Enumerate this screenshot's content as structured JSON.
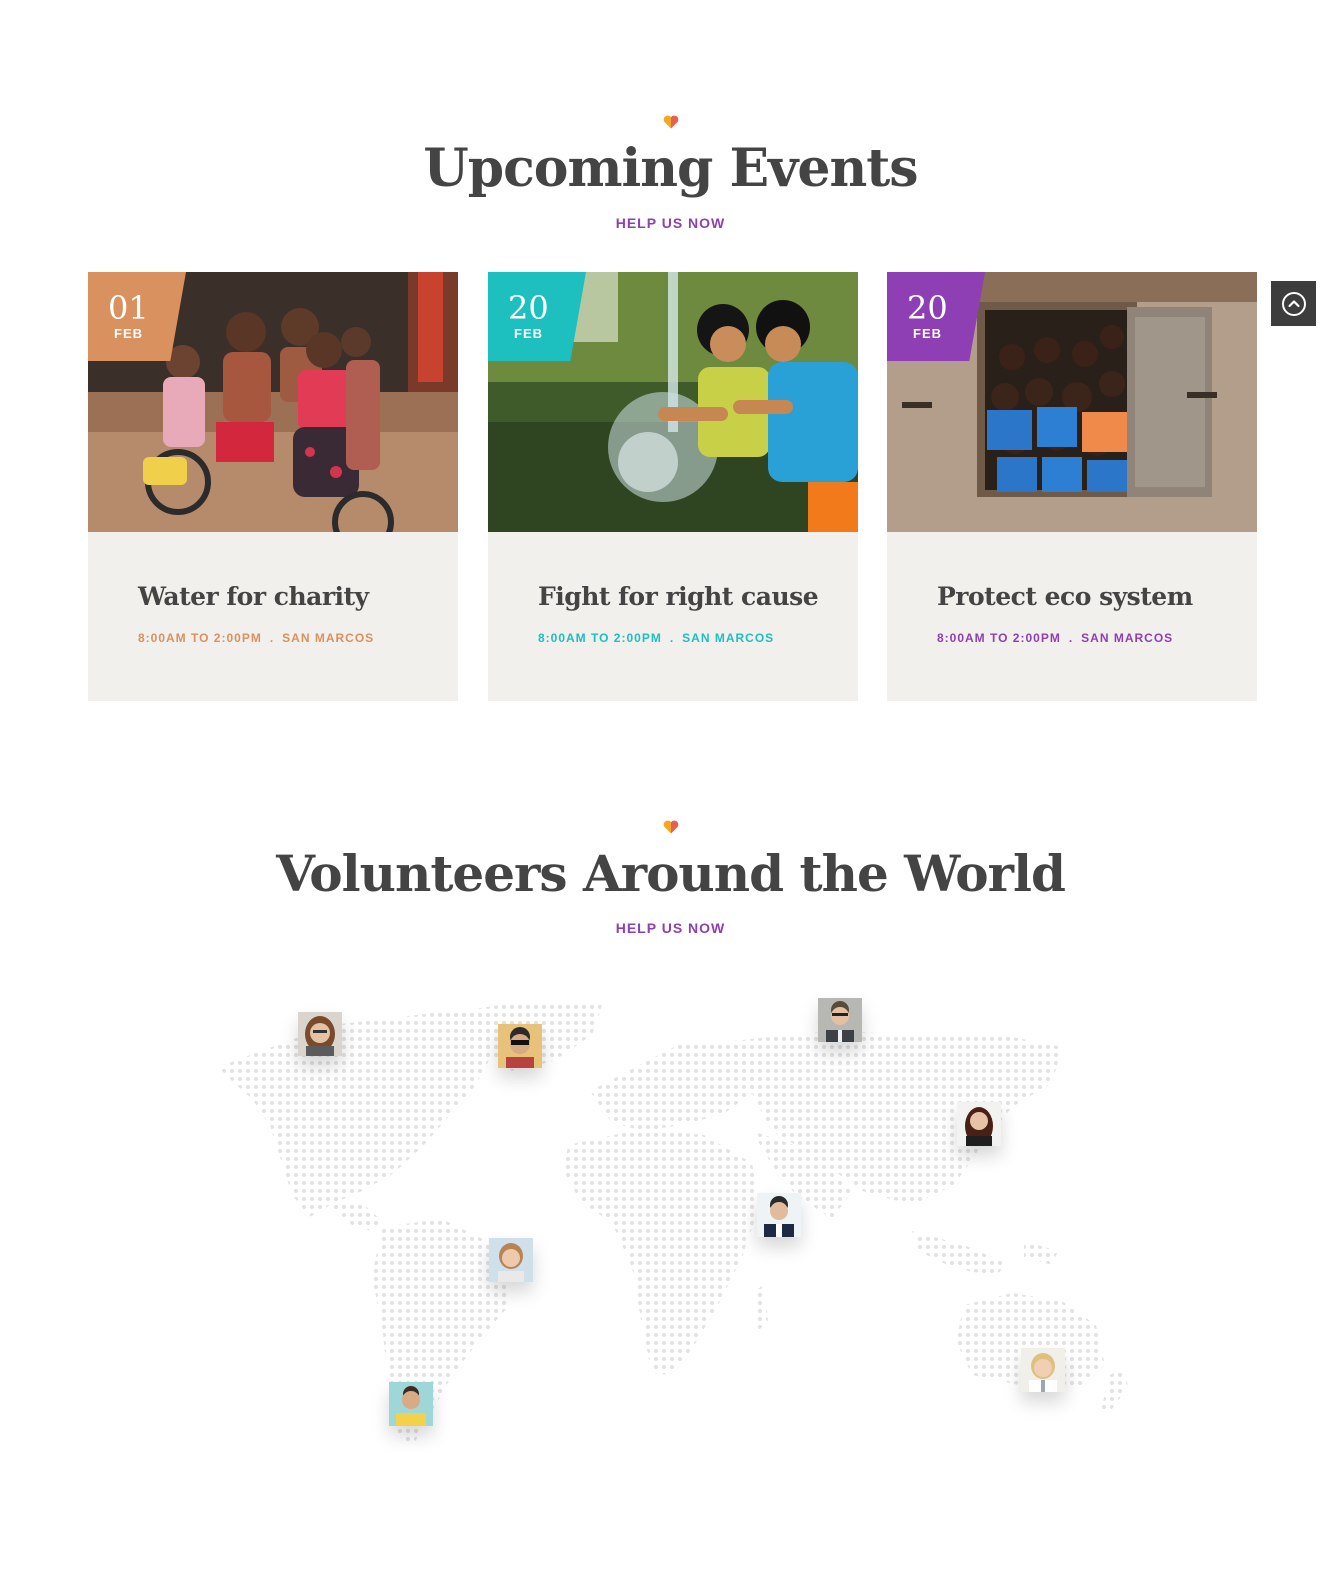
{
  "events_section": {
    "title": "Upcoming Events",
    "subtitle": "HELP US NOW"
  },
  "events": [
    {
      "day": "01",
      "month": "FEB",
      "title": "Water for charity",
      "time": "8:00AM TO 2:00PM",
      "location": "SAN MARCOS",
      "accent": "#d9915f",
      "photo": "children-on-bicycle-photo"
    },
    {
      "day": "20",
      "month": "FEB",
      "title": "Fight for right cause",
      "time": "8:00AM TO 2:00PM",
      "location": "SAN MARCOS",
      "accent": "#1dbfbf",
      "photo": "children-splashing-water-photo"
    },
    {
      "day": "20",
      "month": "FEB",
      "title": "Protect eco system",
      "time": "8:00AM TO 2:00PM",
      "location": "SAN MARCOS",
      "accent": "#8e3fb3",
      "photo": "children-at-window-photo"
    }
  ],
  "volunteers_section": {
    "title": "Volunteers Around the World",
    "subtitle": "HELP US NOW"
  },
  "volunteers": [
    {
      "portrait": "woman-with-glasses"
    },
    {
      "portrait": "man-with-sunglasses"
    },
    {
      "portrait": "man-with-glasses-suit"
    },
    {
      "portrait": "woman-dark-hair"
    },
    {
      "portrait": "man-in-suit"
    },
    {
      "portrait": "woman-smiling"
    },
    {
      "portrait": "man-yellow-shirt"
    },
    {
      "portrait": "woman-blonde-white-coat"
    }
  ],
  "icons": {
    "heart": "heart-icon",
    "scroll_top": "chevron-up-circle-icon"
  },
  "colors": {
    "heading": "#444444",
    "subtitle": "#8e3fb3",
    "card_background": "#f2f0ed",
    "heart_left": "#f5a623",
    "heart_right": "#e8604c",
    "scroll_button": "#3d3d3d"
  }
}
